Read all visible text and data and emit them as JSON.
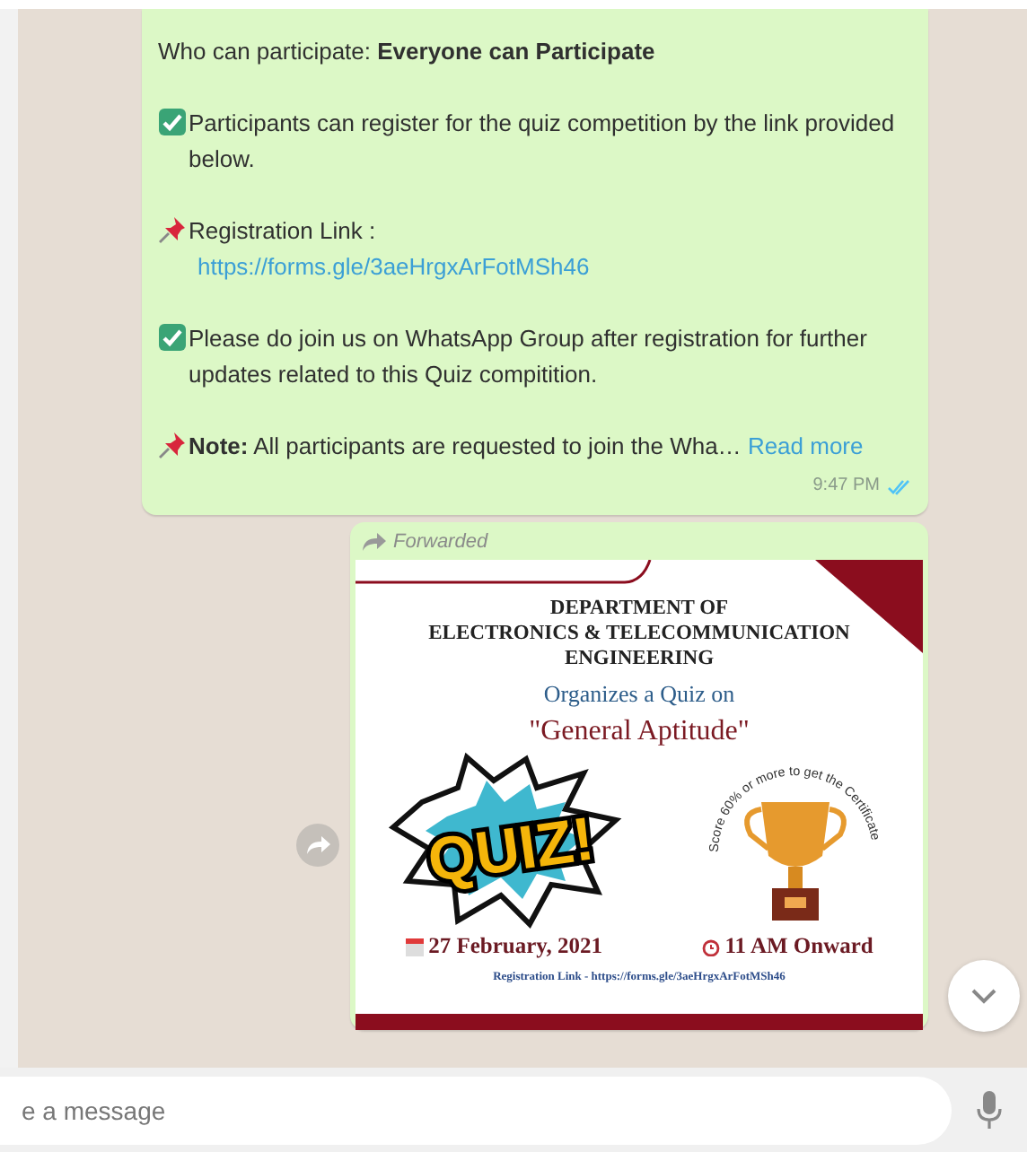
{
  "message_1": {
    "paragraphs": [
      {
        "kind": "text",
        "text": "Who can participate: **Everyone can Participate**"
      },
      {
        "kind": "check",
        "text": "Participants can register for the quiz competition by the link provided below."
      },
      {
        "kind": "pin",
        "text": "Registration Link :",
        "link": "https://forms.gle/3aeHrgxArFotMSh46"
      },
      {
        "kind": "check",
        "text": "Please do join us on WhatsApp Group after registration for further updates related to this Quiz compitition."
      },
      {
        "kind": "pin",
        "text": "**Note:** All participants are requested to join the Wha…",
        "link": "Read more"
      }
    ],
    "time": "9:47 PM",
    "read": true
  },
  "message_2": {
    "forwarded": "Forwarded",
    "poster": {
      "department": "DEPARTMENT OF\nELECTRONICS & TELECOMMUNICATION\nENGINEERING",
      "subtitle": "Organizes a Quiz on",
      "topic": "\"General Aptitude\"",
      "badge": "QUIZ!",
      "arc_text": "Score 60% or more to get the Certificate",
      "date": "27 February, 2021",
      "time": "11 AM Onward",
      "registration": "Registration Link - https://forms.gle/3aeHrgxArFotMSh46"
    }
  },
  "composer": {
    "placeholder": "e a message"
  }
}
